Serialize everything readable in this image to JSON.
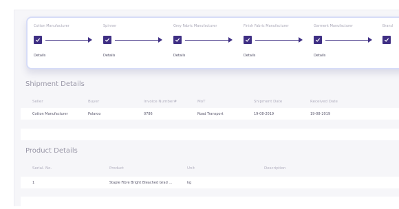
{
  "supply_chain": {
    "stages": [
      {
        "name": "Cotton Manufacturer",
        "details_label": "Details"
      },
      {
        "name": "Spinner",
        "details_label": "Details"
      },
      {
        "name": "Grey Fabric Manufacturer",
        "details_label": "Details"
      },
      {
        "name": "Finish Fabric Manufacturer",
        "details_label": "Details"
      },
      {
        "name": "Garment Manufacturer",
        "details_label": "Details"
      },
      {
        "name": "Brand",
        "details_label": ""
      }
    ],
    "accent_color": "#3f2f84",
    "check_icon": "check-icon",
    "arrow_icon": "arrow-right-icon"
  },
  "shipment": {
    "title": "Shipment Details",
    "columns": [
      "Seller",
      "Buyer",
      "Invoice Number#",
      "MoT",
      "Shipment Date",
      "Received Date"
    ],
    "rows": [
      [
        "Cotton Manufacturer",
        "Polaroo",
        "0786",
        "Road Transport",
        "19-08-2019",
        "19-08-2019"
      ]
    ]
  },
  "product": {
    "title": "Product Details",
    "columns": [
      "Serial. No.",
      "Product",
      "Unit",
      "Description"
    ],
    "rows": [
      [
        "1",
        "Staple Fibre Bright Bleached Grad ...",
        "kg",
        ""
      ]
    ]
  }
}
